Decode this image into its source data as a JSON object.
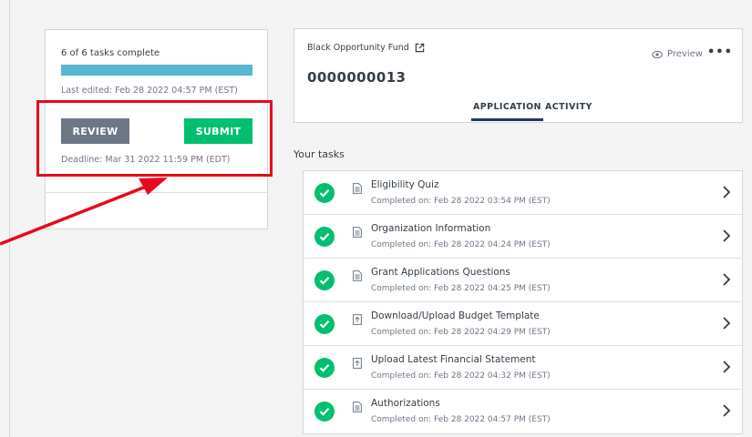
{
  "progress": {
    "summary": "6 of 6 tasks complete",
    "fraction": 1.0,
    "last_edited": "Last edited: Feb 28 2022 04:57 PM (EST)",
    "review_label": "REVIEW",
    "submit_label": "SUBMIT",
    "deadline": "Deadline: Mar 31 2022 11:59 PM (EDT)"
  },
  "header": {
    "fund_name": "Black Opportunity Fund",
    "application_number": "0000000013",
    "preview_label": "Preview",
    "more_label": "•••",
    "tabs": [
      {
        "label": "APPLICATION",
        "active": true
      },
      {
        "label": "ACTIVITY",
        "active": false
      }
    ]
  },
  "tasks_heading": "Your tasks",
  "tasks": [
    {
      "title": "Eligibility Quiz",
      "subtitle": "Completed on: Feb 28 2022 03:54 PM (EST)",
      "icon": "document-icon"
    },
    {
      "title": "Organization Information",
      "subtitle": "Completed on: Feb 28 2022 04:24 PM (EST)",
      "icon": "document-icon"
    },
    {
      "title": "Grant Applications Questions",
      "subtitle": "Completed on: Feb 28 2022 04:25 PM (EST)",
      "icon": "document-icon"
    },
    {
      "title": "Download/Upload Budget Template",
      "subtitle": "Completed on: Feb 28 2022 04:29 PM (EST)",
      "icon": "upload-icon"
    },
    {
      "title": "Upload Latest Financial Statement",
      "subtitle": "Completed on: Feb 28 2022 04:32 PM (EST)",
      "icon": "upload-icon"
    },
    {
      "title": "Authorizations",
      "subtitle": "Completed on: Feb 28 2022 04:57 PM (EST)",
      "icon": "document-icon"
    }
  ],
  "colors": {
    "progress_fill": "#5bb6d2",
    "submit": "#00bf6f",
    "review": "#6b7787",
    "highlight": "#e8091e",
    "check": "#00bf6f"
  }
}
